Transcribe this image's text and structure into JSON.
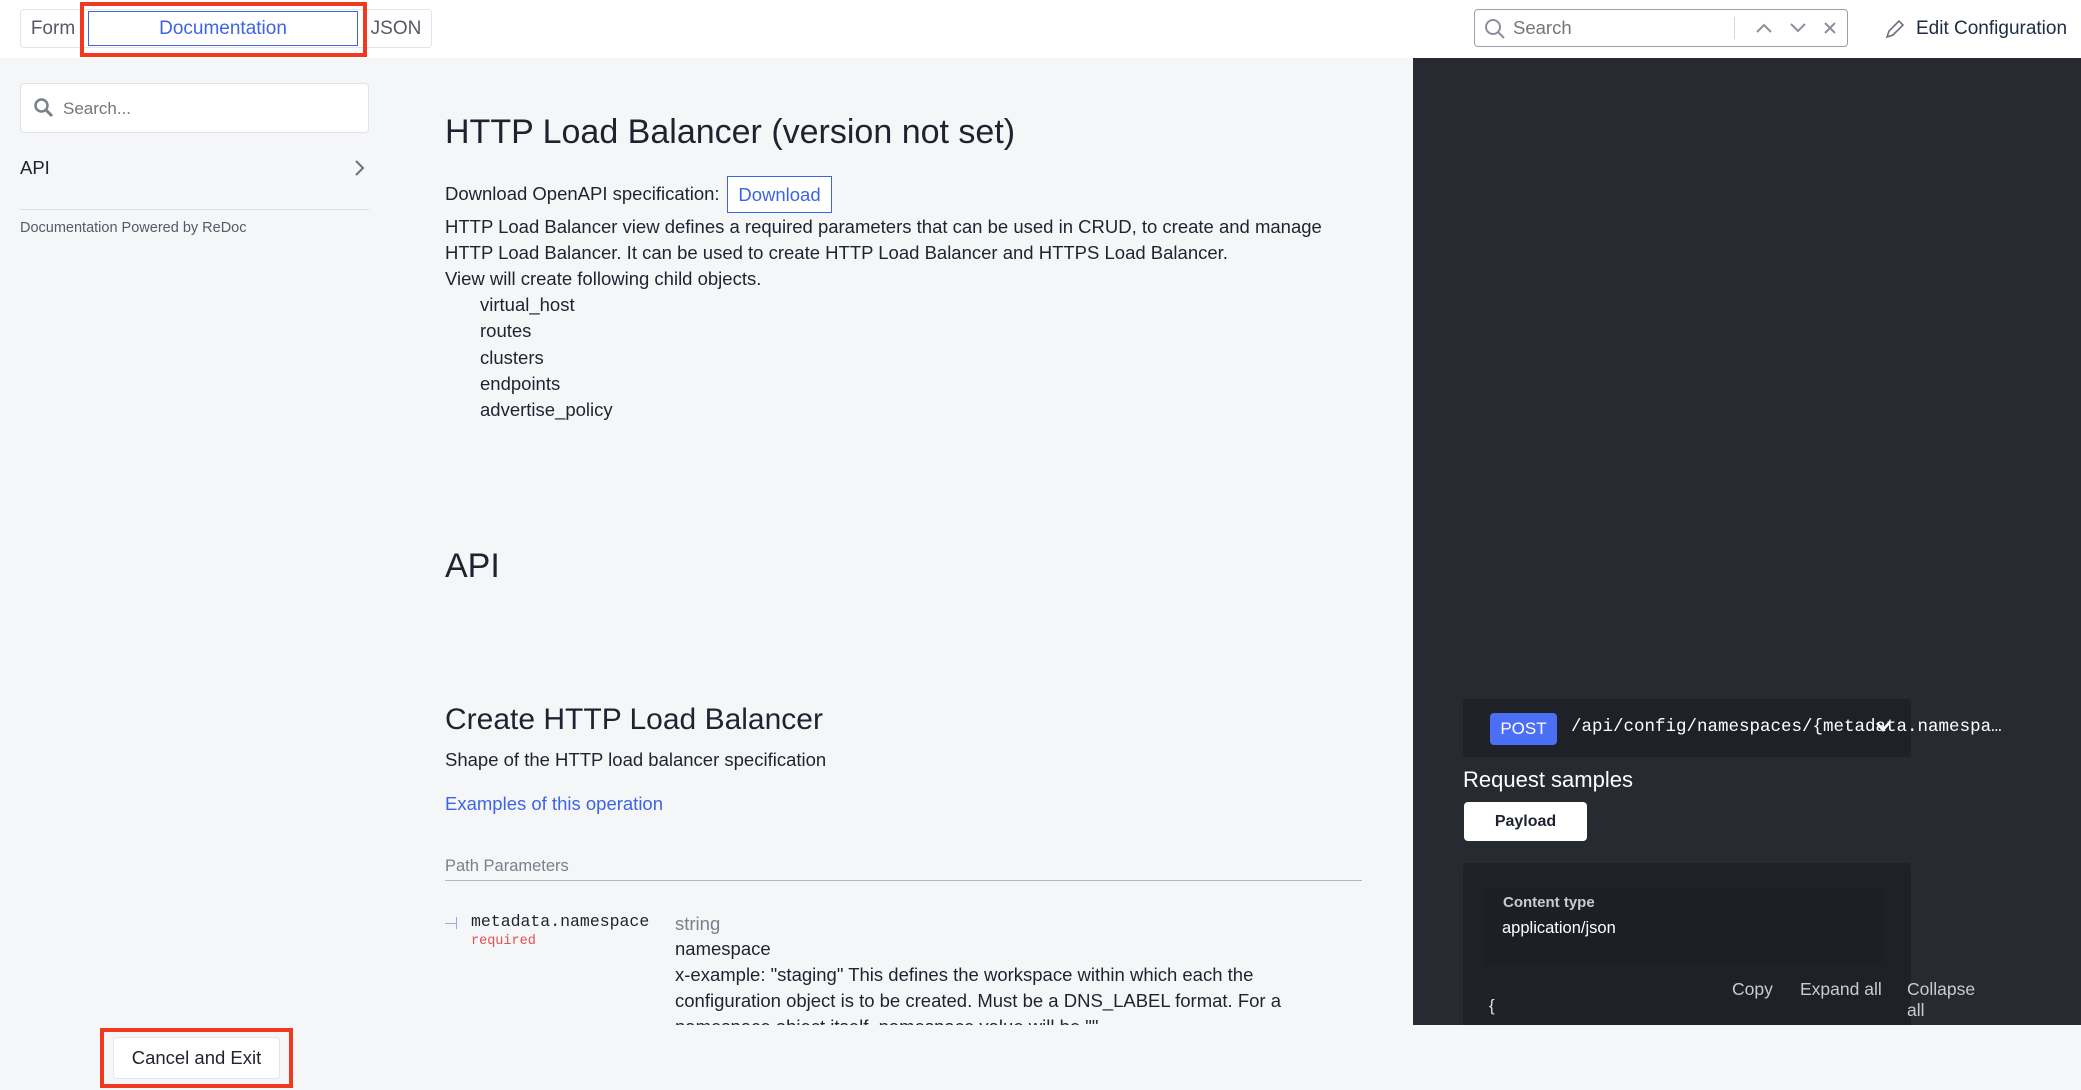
{
  "tabs": {
    "form": "Form",
    "documentation": "Documentation",
    "json": "JSON"
  },
  "top_search": {
    "placeholder": "Search"
  },
  "edit_config": "Edit Configuration",
  "sidebar": {
    "search_placeholder": "Search...",
    "items": [
      {
        "label": "API"
      }
    ],
    "powered": "Documentation Powered by ReDoc"
  },
  "main": {
    "title": "HTTP Load Balancer (version not set)",
    "download_label": "Download OpenAPI specification:",
    "download_button": "Download",
    "desc_lines": [
      "HTTP Load Balancer view defines a required parameters that can be used in CRUD, to create and manage",
      "HTTP Load Balancer. It can be used to create HTTP Load Balancer and HTTPS Load Balancer.",
      "View will create following child objects."
    ],
    "child_objects": [
      "virtual_host",
      "routes",
      "clusters",
      "endpoints",
      "advertise_policy"
    ],
    "api_heading": "API",
    "operation": {
      "title": "Create HTTP Load Balancer",
      "summary": "Shape of the HTTP load balancer specification",
      "examples_link": "Examples of this operation",
      "path_params_heading": "Path Parameters",
      "param": {
        "name": "metadata.namespace",
        "required": "required",
        "type": "string",
        "title": "namespace",
        "desc_lines": [
          "x-example: \"staging\" This defines the workspace within which each the",
          "configuration object is to be created. Must be a DNS_LABEL format. For a",
          "namespace object itself, namespace value will be \"\""
        ]
      }
    }
  },
  "right": {
    "method": "POST",
    "path": "/api/config/namespaces/{metadata.namespa…",
    "request_samples": "Request samples",
    "payload_tab": "Payload",
    "content_type_label": "Content type",
    "content_type": "application/json",
    "copy": "Copy",
    "expand_all": "Expand all",
    "collapse_all": "Collapse all",
    "code_start": "{"
  },
  "footer": {
    "cancel": "Cancel and Exit"
  }
}
